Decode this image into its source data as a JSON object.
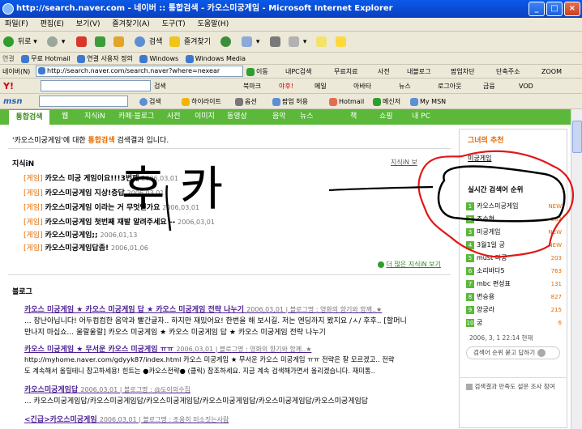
{
  "window": {
    "title": "http://search.naver.com - 네이버 :: 통합검색 - 카오스미궁게임 - Microsoft Internet Explorer",
    "controls": [
      "_",
      "□",
      "×"
    ]
  },
  "menubar": [
    "파일(F)",
    "편집(E)",
    "보기(V)",
    "즐겨찾기(A)",
    "도구(T)",
    "도움말(H)"
  ],
  "stdbar": {
    "back": "뒤로",
    "search": "검색",
    "favorites": "즐겨찾기"
  },
  "links": {
    "label": "연결",
    "items": [
      "무료 Hotmail",
      "연결 사용자 정의",
      "Windows",
      "Windows Media"
    ]
  },
  "address": {
    "label": "네이버(N)",
    "url": "http://search.naver.com/search.naver?where=nexear",
    "go": "이동",
    "extras": [
      "내PC검색",
      "무료치료",
      "사전",
      "내블로그",
      "팝업차단",
      "단축주소",
      "ZOOM"
    ]
  },
  "naverbar": {
    "search": "검색",
    "items": [
      "북마크",
      "야후!",
      "메일",
      "아바타",
      "뉴스",
      "로그아웃",
      "금융",
      "VOD"
    ]
  },
  "msnbar": {
    "logo": "msn",
    "search": "검색",
    "highlight": "하이라이트",
    "options": "옵션",
    "popup": "팝업 허용",
    "hotmail": "Hotmail",
    "messenger": "메신저",
    "mymsn": "My MSN"
  },
  "tabs": [
    "통합검색",
    "웹",
    "지식iN",
    "카페·블로그",
    "사전",
    "이미지",
    "동영상",
    "음악",
    "뉴스",
    "책",
    "쇼핑",
    "내 PC"
  ],
  "intro": {
    "query": "'카오스미궁게임'",
    "mid": "에 대한",
    "label": "통합검색",
    "tail": "검색결과 입니다."
  },
  "kin": {
    "title": "지식iN",
    "more_top": "지식iN 보",
    "items": [
      {
        "tag": "[게임]",
        "text": "카오스 미궁 게임이요!!!3번째",
        "date": "2006,03,01"
      },
      {
        "tag": "[게임]",
        "text": "카오스미궁게임 지상!층답",
        "date": "2006,03,01"
      },
      {
        "tag": "[게임]",
        "text": "카오스미궁게임 이라는 거 무엇인가요",
        "date": "2006,03,01"
      },
      {
        "tag": "[게임]",
        "text": "카오스미궁게임 첫번째 재발 알려주세요 --",
        "date": "2006,03,01"
      },
      {
        "tag": "[게임]",
        "text": "카오스미궁게임;;",
        "date": "2006,01,13"
      },
      {
        "tag": "[게임]",
        "text": "카오스미궁게임답좀!",
        "date": "2006,01,06"
      }
    ],
    "more": "더 많은 지식iN 보기"
  },
  "blog": {
    "title": "블로그",
    "items": [
      {
        "title": "카오스 미궁게임 ★ 카오스 미궁게임 답 ★ 카오스 미궁게임 전략 나누기",
        "meta": "2006,03,01 | 블로그명 : 영화의 향기와 함께..★",
        "lines": [
          "... 장난아닙니다! 어두컴컴한 음악과 빨간글자.. 하지만 재밌어요! 한번을 해 보시길. 저는 엔딩까지 봤지요 /ㅅ/ 후후.. [할머니",
          "만나지 마십쇼... 울랄울랄] 카오스 미궁게임 ★ 카오스 미궁게임 답 ★ 카오스 미궁게임 전략 나누기"
        ]
      },
      {
        "title": "카오스 미궁게임 ★ 무서운 카오스 미궁게임 ㅠㅠ",
        "meta": "2006,03,01 | 블로그명 : 영화의 향기와 함께..★",
        "lines": [
          "http://myhome.naver.com/gdyyk87/index.html 카오스 미궁게임 ★ 무서운 카오스 미궁게임 ㅠㅠ 전략은 잘 모르겠고.. 전략",
          "도 계속해서 올릴테니 참고하세용! 힌트는 ●카오스전략● (클릭) 참조하세요. 지금 계속 검색해가면서 올리겠습니다. 재미통.."
        ]
      },
      {
        "title": "카오스미궁게임답",
        "meta": "2006,03,01 | 블로그명 : @도이의수집",
        "lines": [
          "... 카오스미궁게임답/카오스미궁게임답/카오스미궁게임답/카오스미궁게임답/카오스미궁게임답/카오스미궁게임답"
        ]
      },
      {
        "title": "<긴급>카오스미궁게임",
        "meta": "2006,03,01 | 블로그명 : 조용히 미소짓는사람",
        "lines": []
      }
    ]
  },
  "sidebar": {
    "title": "그녀의 추천",
    "rec": "미궁게임",
    "rank_title": "실시간 검색어 순위",
    "ranks": [
      {
        "n": "1",
        "text": "카오스미궁게임",
        "val": "NEW"
      },
      {
        "n": "2",
        "text": "조수현",
        "val": "382"
      },
      {
        "n": "3",
        "text": "미궁게임",
        "val": "NEW"
      },
      {
        "n": "4",
        "text": "3월1일 궁",
        "val": "NEW"
      },
      {
        "n": "5",
        "text": "must 미궁",
        "val": "203"
      },
      {
        "n": "6",
        "text": "소리바다5",
        "val": "763"
      },
      {
        "n": "7",
        "text": "mbc 편성표",
        "val": "131"
      },
      {
        "n": "8",
        "text": "변승용",
        "val": "827"
      },
      {
        "n": "9",
        "text": "양궁라",
        "val": "215"
      },
      {
        "n": "10",
        "text": "궁",
        "val": "6"
      }
    ],
    "timestamp": "2006, 3, 1  22:14  현재",
    "poll": "검색어 순위 묻고 답하기",
    "feedback": "검색결과 만족도 설문 조사 참여"
  },
  "handwriting": "후 카"
}
